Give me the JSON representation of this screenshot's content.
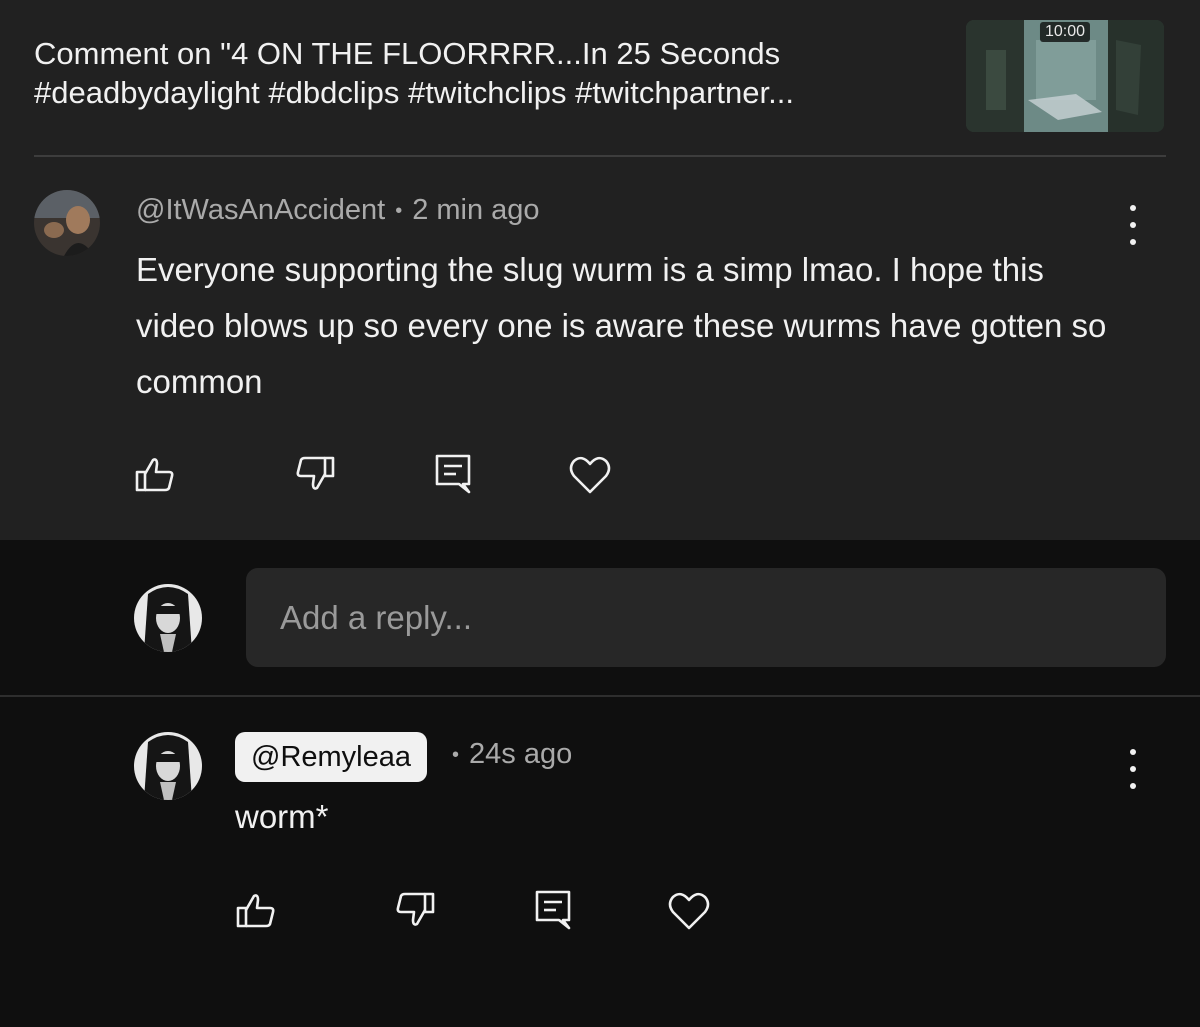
{
  "header": {
    "title": "Comment on \"4 ON THE FLOORRRR...In 25 Seconds\n#deadbydaylight #dbdclips #twitchclips #twitchpartner...",
    "thumbnail_duration": "10:00"
  },
  "comment": {
    "author": "@ItWasAnAccident",
    "time": "2 min ago",
    "text": "Everyone supporting the slug wurm is a simp lmao. I hope this video blows up so every one is aware these wurms have gotten so common"
  },
  "reply_box": {
    "placeholder": "Add a reply..."
  },
  "reply": {
    "author": "@Remyleaa",
    "time": "24s ago",
    "text": "worm*"
  },
  "separator": "•",
  "icons": {
    "like": "thumbs-up-icon",
    "dislike": "thumbs-down-icon",
    "reply": "comment-reply-icon",
    "heart": "heart-icon",
    "more": "more-vertical-icon"
  },
  "colors": {
    "top_background": "#212121",
    "page_background": "#0f0f0f",
    "text_primary": "#f1f1f1",
    "text_secondary": "#aaaaaa",
    "input_background": "#272727"
  }
}
